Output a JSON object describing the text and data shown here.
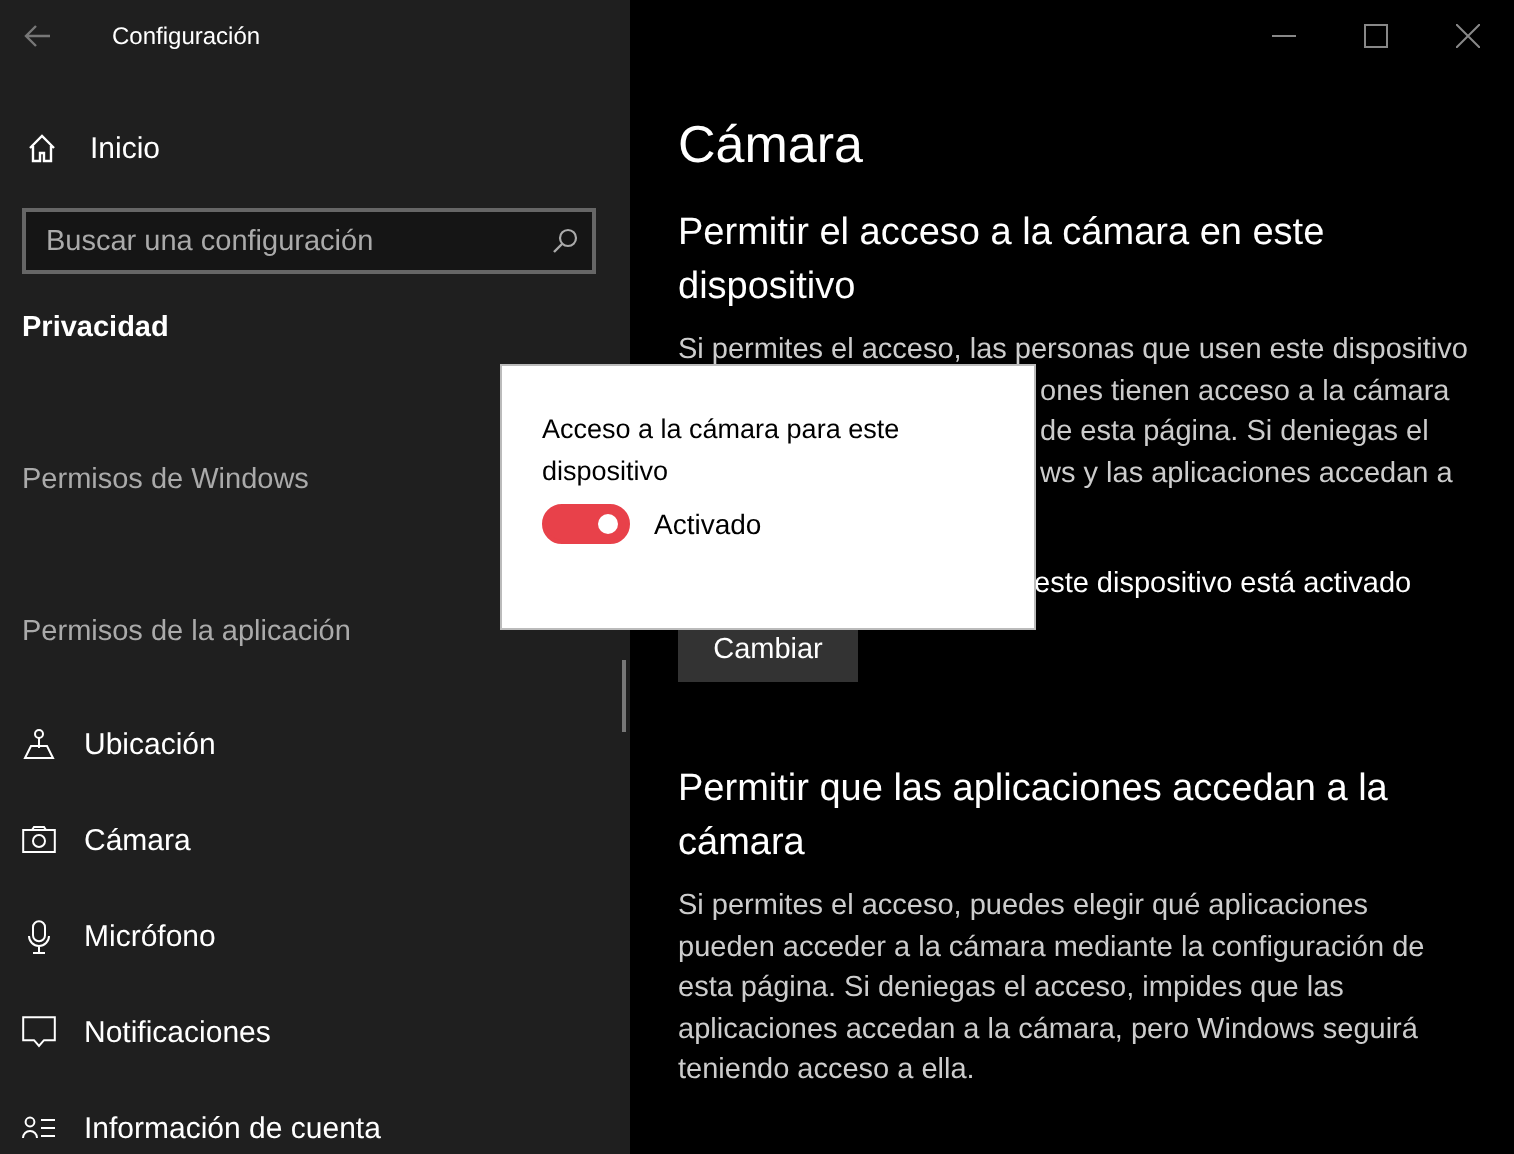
{
  "window": {
    "title": "Configuración"
  },
  "sidebar": {
    "home": "Inicio",
    "search": {
      "placeholder": "Buscar una configuración"
    },
    "heading": "Privacidad",
    "groups": [
      {
        "title": "Permisos de Windows"
      },
      {
        "title": "Permisos de la aplicación",
        "items": [
          {
            "label": "Ubicación"
          },
          {
            "label": "Cámara"
          },
          {
            "label": "Micrófono"
          },
          {
            "label": "Notificaciones"
          },
          {
            "label": "Información de cuenta"
          }
        ]
      }
    ]
  },
  "content": {
    "title": "Cámara",
    "sections": [
      {
        "heading": "Permitir el acceso a la cámara en este dispositivo",
        "lines": [
          "Si permites el acceso, las personas que usen este dispositivo"
        ],
        "line_ends": [
          "ones tienen acceso a la cámara",
          "de esta página. Si deniegas el",
          "ws y las aplicaciones accedan a"
        ],
        "status": "este dispositivo está activado",
        "button": "Cambiar"
      },
      {
        "heading": "Permitir que las aplicaciones accedan a la cámara",
        "lines": [
          "Si permites el acceso, puedes elegir qué aplicaciones",
          "pueden acceder a la cámara mediante la configuración de",
          "esta página. Si deniegas el acceso, impides que las",
          "aplicaciones accedan a la cámara, pero Windows seguirá",
          "teniendo acceso a ella."
        ]
      }
    ]
  },
  "popup": {
    "title": "Acceso a la cámara para este dispositivo",
    "toggle": {
      "on": true,
      "label": "Activado"
    }
  }
}
